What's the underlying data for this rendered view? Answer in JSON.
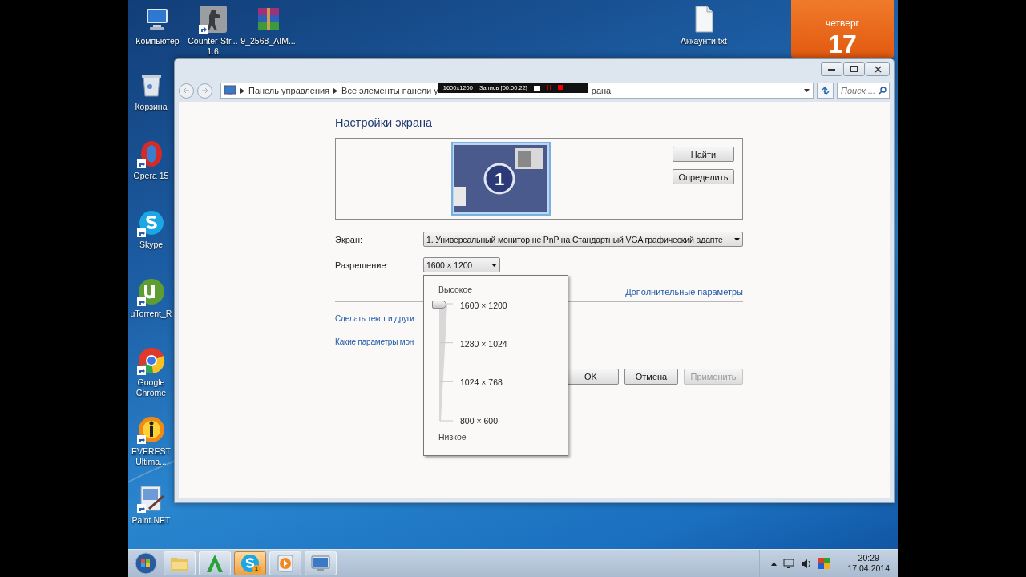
{
  "desktop": {
    "top_icons": [
      {
        "label": "Компьютер",
        "kind": "computer"
      },
      {
        "label": "Counter-Str... 1.6",
        "kind": "game"
      },
      {
        "label": "9_2568_AIM...",
        "kind": "archive"
      }
    ],
    "left_icons": [
      {
        "label": "Корзина",
        "kind": "bin"
      },
      {
        "label": "Opera 15",
        "kind": "opera"
      },
      {
        "label": "Skype",
        "kind": "skype"
      },
      {
        "label": "uTorrent_R",
        "kind": "torrent"
      },
      {
        "label": "Google Chrome",
        "kind": "chrome"
      },
      {
        "label": "EVEREST Ultima...",
        "kind": "everest"
      },
      {
        "label": "Paint.NET",
        "kind": "paint"
      }
    ],
    "file_icon": {
      "label": "Аккаунти.txt",
      "kind": "text"
    }
  },
  "gadget": {
    "weekday": "четверг",
    "day": "17"
  },
  "address_bar": {
    "crumbs": [
      "Панель управления",
      "Все элементы панели у",
      "рана"
    ]
  },
  "recorder_bar": {
    "resolution": "1600x1200",
    "status": "Запись [00:00:22]"
  },
  "search": {
    "placeholder": "Поиск ..."
  },
  "content": {
    "title": "Настройки экрана",
    "display_number": "1",
    "preview_buttons": [
      "Найти",
      "Определить"
    ],
    "fields": [
      {
        "label": "Экран:",
        "value": "1. Универсальный монитор не PnP на Стандартный VGA графический адапте",
        "kind": "wide"
      },
      {
        "label": "Разрешение:",
        "value": "1600 × 1200",
        "kind": "narrow"
      }
    ],
    "advanced_link": "Дополнительные параметры",
    "links": [
      "Сделать текст и други",
      "Какие параметры мон"
    ],
    "dialog_buttons": [
      {
        "label": "OK",
        "disabled": false
      },
      {
        "label": "Отмена",
        "disabled": false
      },
      {
        "label": "Применить",
        "disabled": true
      }
    ]
  },
  "resolution_popup": {
    "high_label": "Высокое",
    "low_label": "Низкое",
    "level": 1,
    "options": [
      "1600 × 1200",
      "1280 × 1024",
      "1024 × 768",
      "800 × 600"
    ]
  },
  "taskbar": {
    "apps": [
      {
        "kind": "explorer",
        "flashing": false
      },
      {
        "kind": "letter-app",
        "flashing": false
      },
      {
        "kind": "skype",
        "flashing": true,
        "badge": "1"
      },
      {
        "kind": "player",
        "flashing": false
      },
      {
        "kind": "display",
        "flashing": false
      }
    ],
    "time": "20:29",
    "date": "17.04.2014"
  }
}
